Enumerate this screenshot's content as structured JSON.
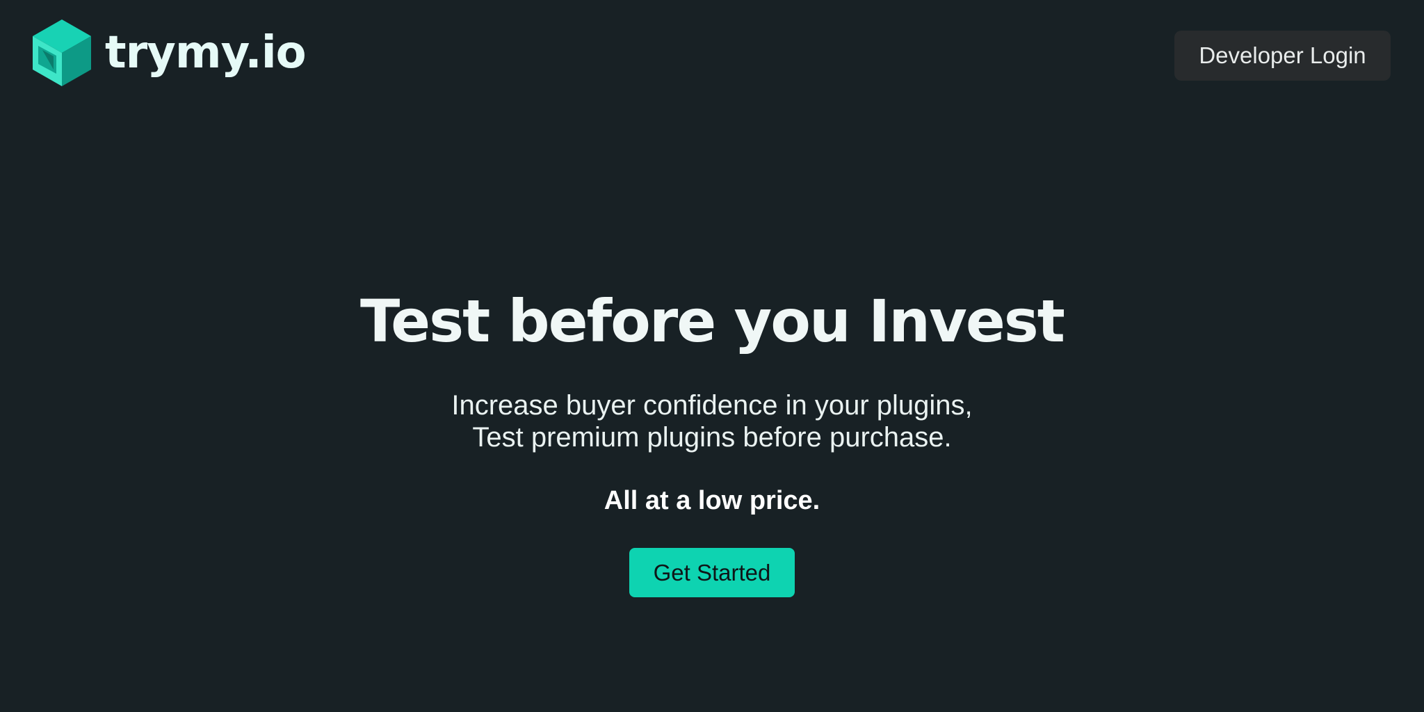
{
  "header": {
    "brand_name": "trymy.io",
    "logo_icon": "green-cube-icon",
    "login_label": "Developer Login"
  },
  "hero": {
    "title": "Test before you Invest",
    "subtitle_line1": "Increase buyer confidence in your plugins,",
    "subtitle_line2": "Test premium plugins before purchase.",
    "price_line": "All at a low price.",
    "cta_label": "Get Started"
  },
  "colors": {
    "background": "#182125",
    "accent": "#0ed3b1",
    "login_button_bg": "#282b2d",
    "text": "#eef6f5"
  }
}
